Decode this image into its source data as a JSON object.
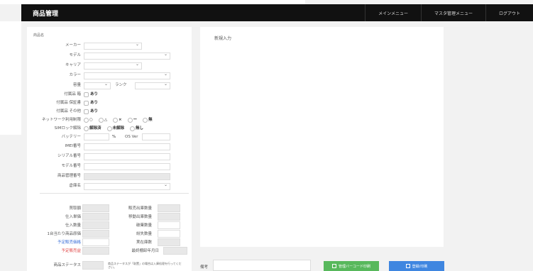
{
  "header": {
    "title": "商品管理",
    "nav": [
      "メインメニュー",
      "マスタ管理メニュー",
      "ログアウト"
    ]
  },
  "left_panel": {
    "section_label": "商品名",
    "fields": {
      "maker": "メーカー",
      "model": "モデル",
      "carrier": "キャリア",
      "color": "カラー",
      "capacity": "容量",
      "rank": "ランク",
      "acc_box": "付属品 箱",
      "acc_manual": "付属品 保証書",
      "acc_other": "付属品 その他",
      "network": "ネットワーク利用制限",
      "sim": "SIMロック解除",
      "battery": "バッテリー",
      "battery_unit": "%",
      "os": "OS Ver",
      "imei": "IMEI番号",
      "serial": "シリアル番号",
      "model_no": "モデル番号",
      "mgmt_no": "商品管理番号",
      "warehouse": "倉庫名"
    },
    "checkbox_label": "あり",
    "network_opts": [
      "○",
      "△",
      "×",
      "ー",
      "無"
    ],
    "sim_opts": [
      "解除済",
      "未解除",
      "無し"
    ],
    "pricing": {
      "purchase_amount": "買取額",
      "unit_price": "仕入単価",
      "quantity": "仕入数量",
      "unit_cost": "1台当たり商品原価",
      "planned_price": "予定販売価格",
      "planned_profit": "予定販売益",
      "sale_qty": "販売出庫数量",
      "move_qty": "移動出庫数量",
      "defect_qty": "破棄数量",
      "loss_qty": "紛失数量",
      "actual_stock": "実在庫数",
      "last_sold": "最終棚卸年月日"
    },
    "status_label": "商品ステータス",
    "status_note": "商品ステータスが「取置」の場合は入庫処理を行ってください。"
  },
  "right_panel": {
    "label": "新規入力"
  },
  "footer": {
    "remarks_label": "備考",
    "print_btn": "管理バーコード印刷",
    "register_btn": "登録/印刷"
  }
}
